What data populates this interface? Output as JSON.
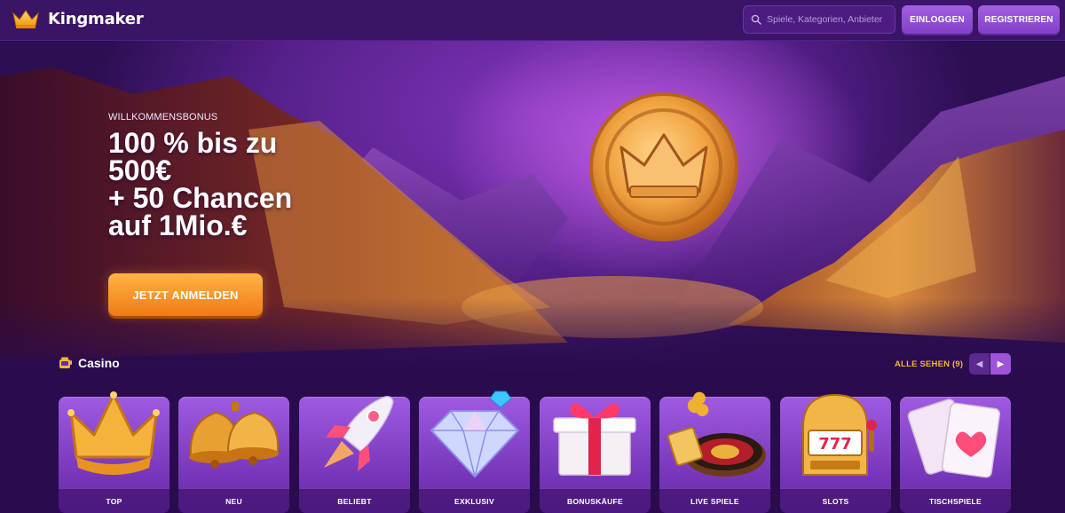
{
  "header": {
    "brand": "Kingmaker",
    "search_placeholder": "Spiele, Kategorien, Anbieter",
    "login_label": "EINLOGGEN",
    "register_label": "REGISTRIEREN"
  },
  "hero": {
    "eyebrow": "WILLKOMMENSBONUS",
    "headline_lines": [
      "100 % bis zu",
      "500€",
      "+ 50 Chancen",
      "auf 1Mio.€"
    ],
    "cta_label": "JETZT ANMELDEN"
  },
  "casino": {
    "title": "Casino",
    "see_all_label": "ALLE SEHEN (9)",
    "categories": [
      {
        "label": "TOP",
        "icon": "crown-icon"
      },
      {
        "label": "NEU",
        "icon": "bell-icon"
      },
      {
        "label": "BELIEBT",
        "icon": "rocket-icon"
      },
      {
        "label": "EXKLUSIV",
        "icon": "diamond-icon"
      },
      {
        "label": "BONUSKÄUFE",
        "icon": "gift-icon"
      },
      {
        "label": "LIVE SPIELE",
        "icon": "roulette-icon"
      },
      {
        "label": "SLOTS",
        "icon": "slot-machine-icon"
      },
      {
        "label": "TISCHSPIELE",
        "icon": "playing-cards-icon"
      }
    ]
  },
  "colors": {
    "header_bg": "#3a1466",
    "page_bg": "#2a0c4e",
    "button_purple": "#9450d6",
    "cta_orange": "#f58a1f",
    "see_all_gold": "#f3b23c"
  }
}
